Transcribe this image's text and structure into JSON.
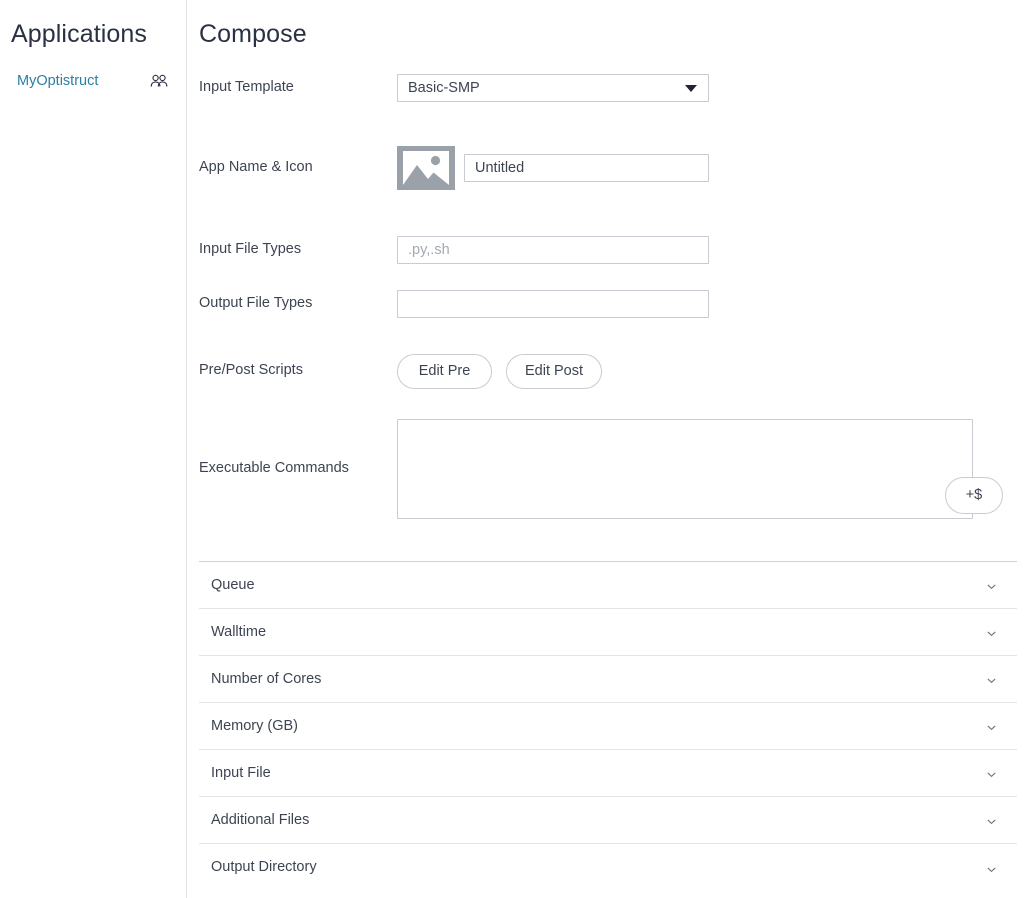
{
  "sidebar": {
    "title": "Applications",
    "items": [
      {
        "label": "MyOptistruct",
        "icon": "people-icon"
      }
    ]
  },
  "main": {
    "page_title": "Compose",
    "fields": {
      "input_template": {
        "label": "Input Template",
        "value": "Basic-SMP",
        "caret_icon": "chevron-down-icon"
      },
      "app_name_icon": {
        "label": "App Name & Icon",
        "thumb_icon": "image-placeholder-icon",
        "value": "Untitled",
        "placeholder": "Untitled"
      },
      "input_file_types": {
        "label": "Input File Types",
        "value": "",
        "placeholder": ".py,.sh"
      },
      "output_file_types": {
        "label": "Output File Types",
        "value": "",
        "placeholder": ""
      },
      "pre_post_scripts": {
        "label": "Pre/Post Scripts",
        "edit_pre_label": "Edit Pre",
        "edit_post_label": "Edit Post"
      },
      "executable_commands": {
        "label": "Executable Commands",
        "value": "",
        "placeholder": "",
        "add_variable_label": "+$"
      }
    },
    "accordion": [
      {
        "label": "Queue",
        "icon": "chevron-down-icon"
      },
      {
        "label": "Walltime",
        "icon": "chevron-down-icon"
      },
      {
        "label": "Number of Cores",
        "icon": "chevron-down-icon"
      },
      {
        "label": "Memory (GB)",
        "icon": "chevron-down-icon"
      },
      {
        "label": "Input File",
        "icon": "chevron-down-icon"
      },
      {
        "label": "Additional Files",
        "icon": "chevron-down-icon"
      },
      {
        "label": "Output Directory",
        "icon": "chevron-down-icon"
      }
    ]
  },
  "colors": {
    "link": "#2b7fa3",
    "heading": "#2a3142",
    "text": "#3d4451",
    "border": "#c8ccd2",
    "placeholder": "#a3a9b2",
    "thumb_bg": "#9aa1a9"
  }
}
